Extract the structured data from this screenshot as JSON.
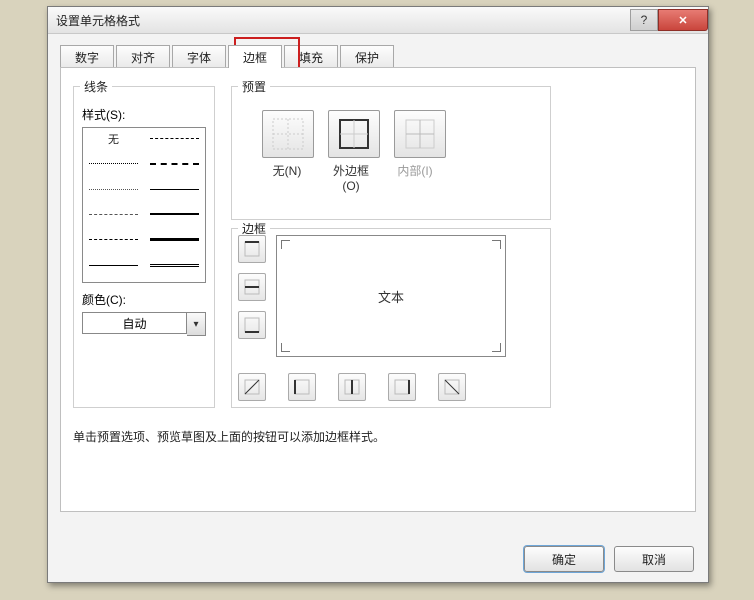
{
  "window": {
    "title": "设置单元格格式"
  },
  "tabs": [
    "数字",
    "对齐",
    "字体",
    "边框",
    "填充",
    "保护"
  ],
  "active_tab_index": 3,
  "line_section": {
    "legend": "线条",
    "style_label": "样式(S):",
    "none_label": "无",
    "color_label": "颜色(C):",
    "color_value": "自动"
  },
  "preset_section": {
    "legend": "预置",
    "labels": {
      "none": "无(N)",
      "outer": "外边框(O)",
      "inner": "内部(I)"
    }
  },
  "border_section": {
    "legend": "边框",
    "preview_text": "文本"
  },
  "hint": "单击预置选项、预览草图及上面的按钮可以添加边框样式。",
  "buttons": {
    "ok": "确定",
    "cancel": "取消"
  }
}
